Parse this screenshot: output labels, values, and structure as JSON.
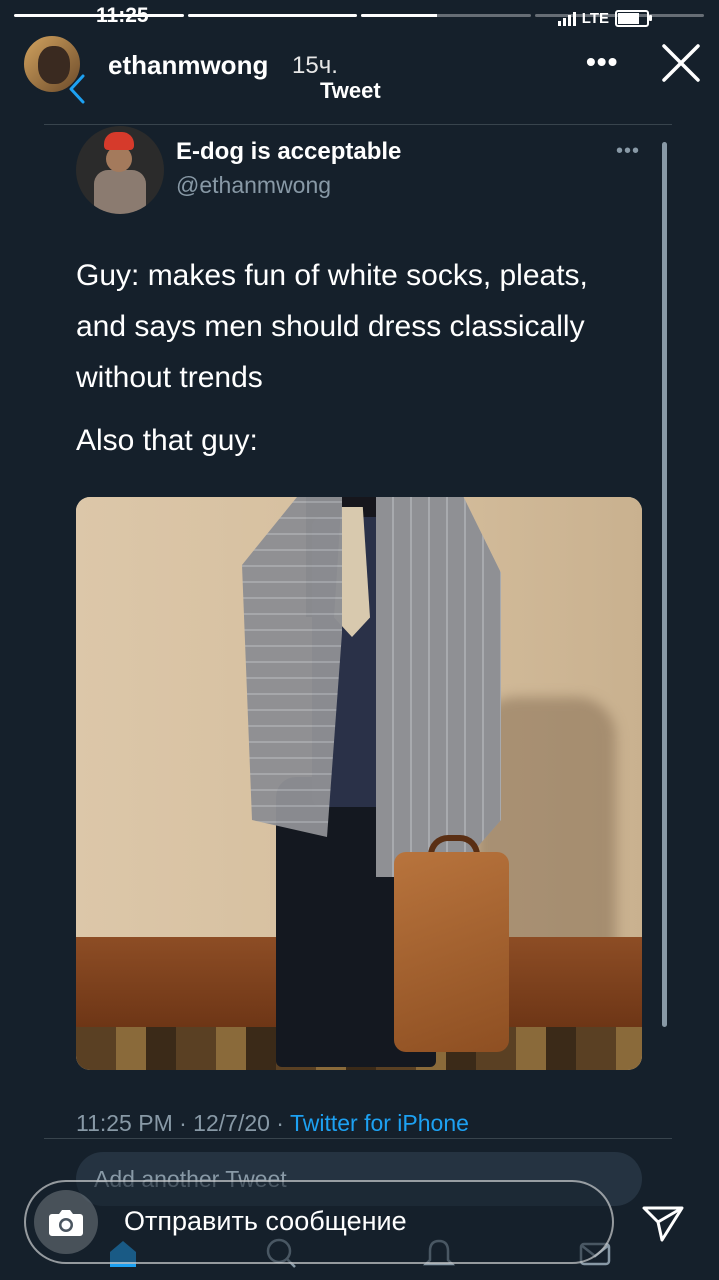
{
  "status_bar": {
    "time": "11:25",
    "network": "LTE",
    "battery_level": 0.75
  },
  "story": {
    "progress": [
      1,
      1,
      0.45,
      0
    ],
    "username": "ethanmwong",
    "time_ago": "15ч.",
    "screen_title": "Tweet",
    "more_label": "•••"
  },
  "tweet": {
    "display_name": "E-dog is acceptable",
    "handle": "@ethanmwong",
    "more_label": "•••",
    "text_lines": [
      "Guy: makes fun of white socks, pleats, and says men should dress classically without trends",
      "Also that guy:"
    ],
    "timestamp": "11:25 PM · 12/7/20 · ",
    "source": "Twitter for iPhone",
    "reply_placeholder": "Add another Tweet"
  },
  "message_bar": {
    "placeholder": "Отправить сообщение"
  },
  "colors": {
    "background": "#15202b",
    "accent": "#1da1f2",
    "muted": "#8899a6",
    "divider": "#38444d"
  },
  "icons": [
    "camera-icon",
    "send-icon",
    "close-icon",
    "back-chevron-icon",
    "home-icon",
    "search-icon",
    "notifications-icon",
    "messages-icon"
  ]
}
